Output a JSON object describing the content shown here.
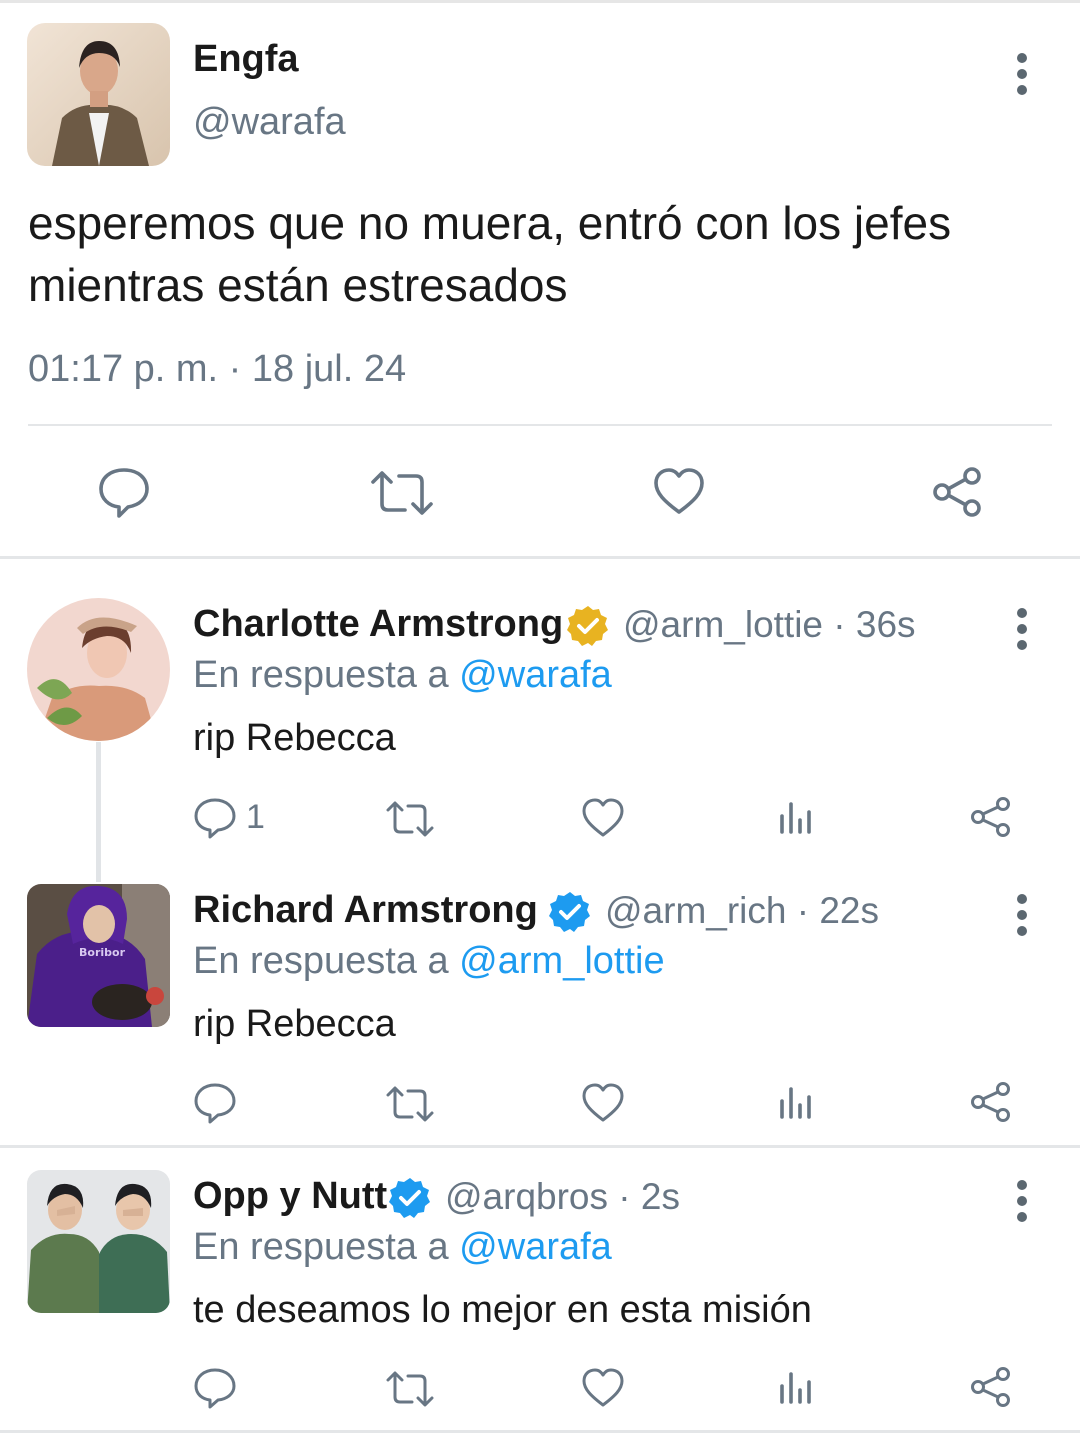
{
  "main_tweet": {
    "name": "Engfa",
    "handle": "@warafa",
    "text_line1": "esperemos que no muera, entró con los jefes",
    "text_line2": "mientras están estresados",
    "timestamp": "01:17 p. m. · 18 jul. 24"
  },
  "replies": [
    {
      "name": "Charlotte Armstrong",
      "handle_time": "@arm_lottie · 36s",
      "reply_prefix": "En respuesta a",
      "reply_to": "@warafa",
      "text": "rip Rebecca",
      "reply_count": "1",
      "badge_color": "#e8b321"
    },
    {
      "name": "Richard Armstrong",
      "handle_time": "@arm_rich · 22s",
      "reply_prefix": "En respuesta a",
      "reply_to": "@arm_lottie",
      "text": "rip Rebecca",
      "reply_count": "",
      "badge_color": "#1d9bf0"
    },
    {
      "name": "Opp y Nutt",
      "handle_time": "@arqbros · 2s",
      "reply_prefix": "En respuesta a",
      "reply_to": "@warafa",
      "text": "te deseamos lo mejor en esta misión",
      "reply_count": "",
      "badge_color": "#1d9bf0"
    }
  ],
  "icons": {
    "reply": "comment-icon",
    "retweet": "retweet-icon",
    "like": "heart-icon",
    "views": "analytics-icon",
    "share": "share-icon",
    "more": "more-vertical-icon",
    "verified": "verified-badge-icon"
  },
  "colors": {
    "icon_gray": "#687684",
    "link_blue": "#1d9bf0",
    "gold_badge": "#e8b321",
    "blue_badge": "#1d9bf0"
  }
}
